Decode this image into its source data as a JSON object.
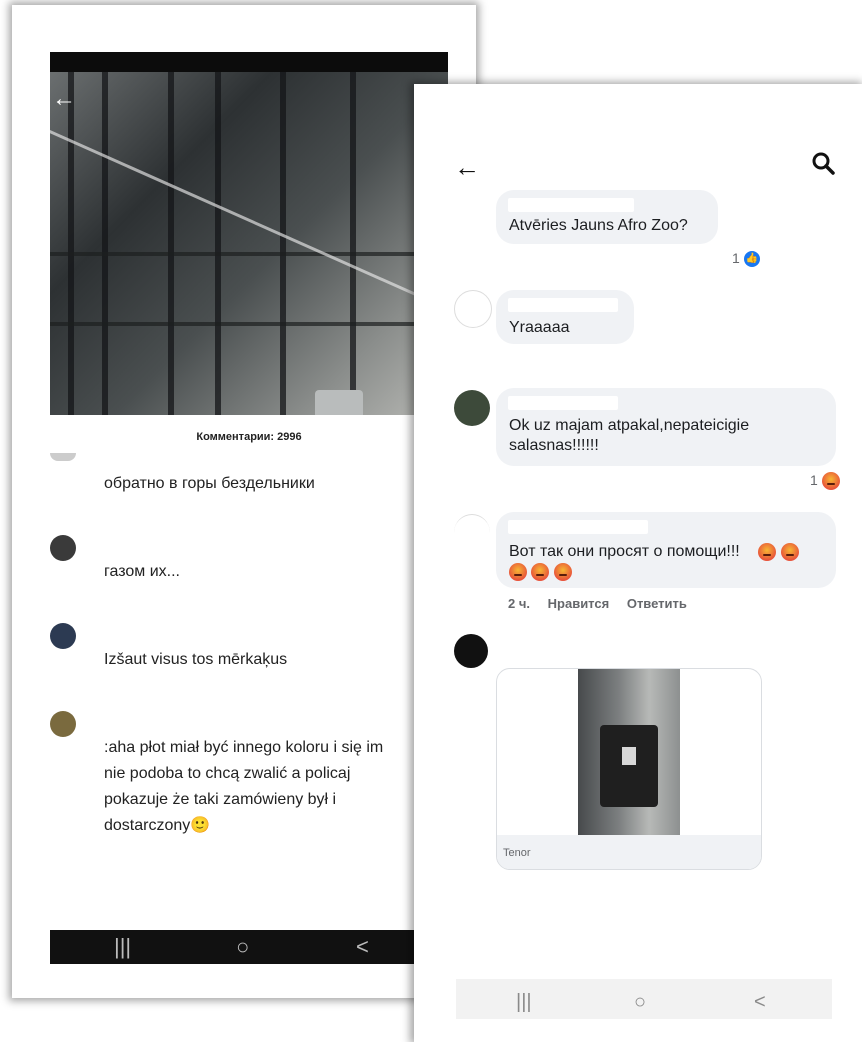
{
  "tiktok": {
    "comments_count": "Комментарии: 2996",
    "comments": [
      {
        "text": "обратно в горы бездельники"
      },
      {
        "text": "газом их..."
      },
      {
        "text": "Izšaut visus tos mērkaķus"
      },
      {
        "text": ":aha płot miał być innego koloru i się im nie podoba to chcą zwalić a policaj pokazuje że taki zamówieny był i dostarczony",
        "emoji": "🙂"
      }
    ],
    "navbar": {
      "recent": "|||",
      "home": "○",
      "back": "<"
    }
  },
  "facebook": {
    "comments": [
      {
        "text": "Atvēries Jauns Afro Zoo?",
        "reaction_count": "1"
      },
      {
        "text": "Yraaaaa"
      },
      {
        "text": "Ok uz majam atpakal,nepateicigie salasnas!!!!!!",
        "reaction_count": "1"
      },
      {
        "text": "Вот так они просят о помощи!!!"
      }
    ],
    "actions": {
      "time": "2 ч.",
      "like": "Нравится",
      "reply": "Ответить"
    },
    "gif_source": "Tenor",
    "navbar": {
      "recent": "|||",
      "home": "○",
      "back": "<"
    }
  },
  "colors": {
    "fb_blue": "#1877f2",
    "bubble_bg": "#f0f2f5",
    "meta_gray": "#65676b"
  },
  "icons": [
    "back-arrow-icon",
    "search-icon",
    "like-reaction-icon",
    "angry-reaction-icon"
  ]
}
